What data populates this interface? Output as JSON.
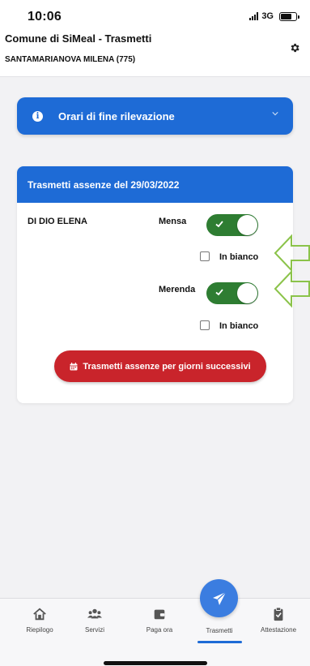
{
  "status": {
    "time": "10:06",
    "network": "3G"
  },
  "header": {
    "title": "Comune di SiMeal - Trasmetti",
    "subtitle": "SANTAMARIANOVA MILENA (775)"
  },
  "accordion": {
    "label": "Orari di fine rilevazione"
  },
  "card": {
    "title": "Trasmetti assenze del 29/03/2022",
    "person": "DI DIO ELENA",
    "services": [
      {
        "label": "Mensa",
        "enabled": true,
        "blank_label": "In bianco",
        "blank_checked": false
      },
      {
        "label": "Merenda",
        "enabled": true,
        "blank_label": "In bianco",
        "blank_checked": false
      }
    ],
    "button_label": "Trasmetti assenze per giorni successivi"
  },
  "tabs": [
    {
      "label": "Riepilogo",
      "icon": "home-icon"
    },
    {
      "label": "Servizi",
      "icon": "users-icon"
    },
    {
      "label": "Paga ora",
      "icon": "wallet-icon"
    },
    {
      "label": "Trasmetti",
      "icon": "paper-plane-icon",
      "active": true
    },
    {
      "label": "Attestazione",
      "icon": "clipboard-check-icon"
    }
  ],
  "colors": {
    "primary": "#1e6bd6",
    "toggle_on": "#2e7d32",
    "danger": "#c9242b",
    "annotation_arrow": "#8bc34a"
  }
}
